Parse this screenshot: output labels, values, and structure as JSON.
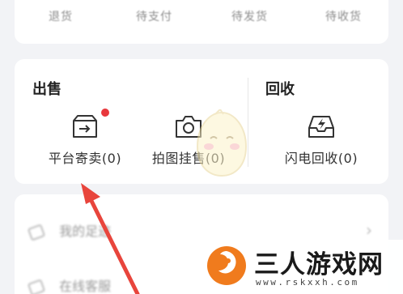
{
  "top_tabs": [
    {
      "label": "退货",
      "icon": "return-icon"
    },
    {
      "label": "待支付",
      "icon": "wallet-icon"
    },
    {
      "label": "待发货",
      "icon": "package-icon"
    },
    {
      "label": "待收货",
      "icon": "truck-icon"
    }
  ],
  "sell": {
    "title": "出售",
    "items": [
      {
        "label": "平台寄卖(0)",
        "icon": "consign-box-icon",
        "has_badge": true
      },
      {
        "label": "拍图挂售(0)",
        "icon": "camera-icon",
        "has_badge": false
      }
    ]
  },
  "recycle": {
    "title": "回收",
    "items": [
      {
        "label": "闪电回收(0)",
        "icon": "lightning-inbox-icon"
      }
    ]
  },
  "list": {
    "items": [
      {
        "label": "我的足迹",
        "icon": "eraser-icon"
      },
      {
        "label": "在线客服",
        "icon": "service-icon"
      }
    ]
  },
  "watermark": {
    "name": "三人游戏网",
    "url": "www.rskxxh.com"
  },
  "colors": {
    "accent_arrow": "#e8453c",
    "badge": "#e8383d",
    "logo_orange": "#f07b1d"
  }
}
